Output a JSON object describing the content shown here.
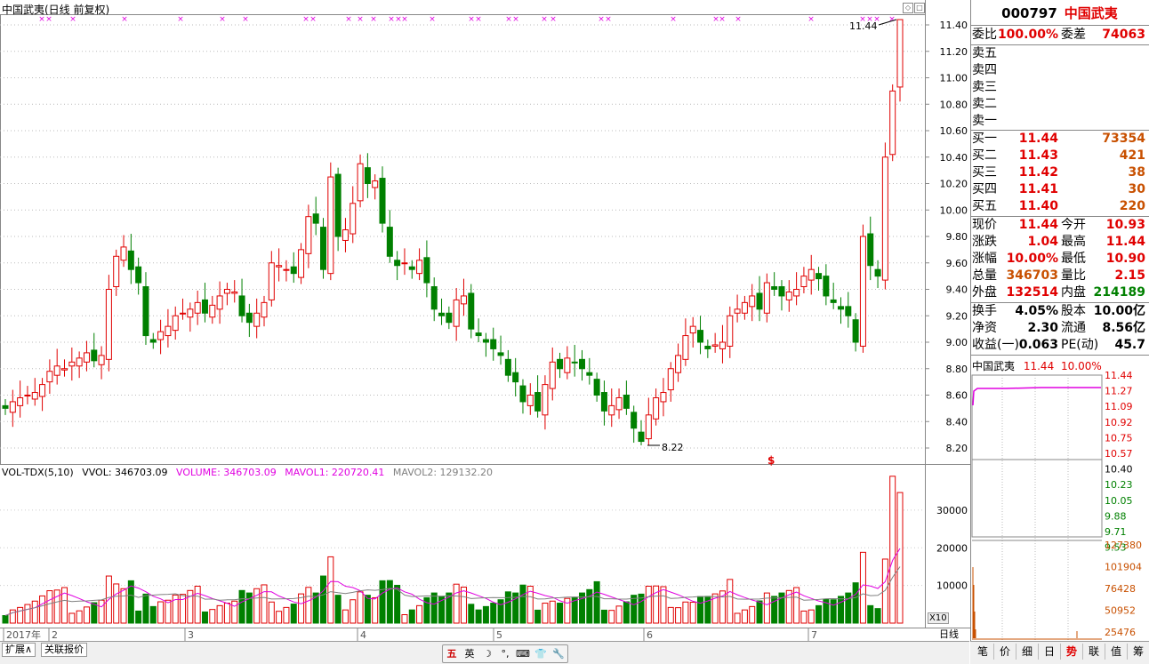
{
  "chart": {
    "title": "中国武夷(日线 前复权)",
    "price_axis": [
      "11.40",
      "11.20",
      "11.00",
      "10.80",
      "10.60",
      "10.40",
      "10.20",
      "10.00",
      "9.80",
      "9.60",
      "9.40",
      "9.20",
      "9.00",
      "8.80",
      "8.60",
      "8.40",
      "8.20"
    ],
    "high_label": "11.44",
    "low_label": "8.22",
    "volume_axis": [
      "30000",
      "20000",
      "10000"
    ],
    "x_labels": [
      "2017年",
      "2",
      "3",
      "4",
      "5",
      "6",
      "7"
    ],
    "scale_label": "X10",
    "period_tab": "日线",
    "marker": "$"
  },
  "volume_legend": {
    "name": "VOL-TDX(5,10)",
    "vvol": "VVOL: 346703.09",
    "volume": "VOLUME: 346703.09",
    "mavol1": "MAVOL1: 220720.41",
    "mavol2": "MAVOL2: 129132.20"
  },
  "bottom_tabs": [
    "扩展∧",
    "关联报价"
  ],
  "ime": [
    "五",
    "英",
    "☽",
    "°,",
    "⌨",
    "👕",
    "🔧"
  ],
  "quote": {
    "code": "000797",
    "name": "中国武夷",
    "weibi_label": "委比",
    "weibi": "100.00%",
    "weicha_label": "委差",
    "weicha": "74063",
    "sell": [
      {
        "label": "卖五"
      },
      {
        "label": "卖四"
      },
      {
        "label": "卖三"
      },
      {
        "label": "卖二"
      },
      {
        "label": "卖一"
      }
    ],
    "buy": [
      {
        "label": "买一",
        "price": "11.44",
        "vol": "73354"
      },
      {
        "label": "买二",
        "price": "11.43",
        "vol": "421"
      },
      {
        "label": "买三",
        "price": "11.42",
        "vol": "38"
      },
      {
        "label": "买四",
        "price": "11.41",
        "vol": "30"
      },
      {
        "label": "买五",
        "price": "11.40",
        "vol": "220"
      }
    ],
    "stats": [
      {
        "l1": "现价",
        "v1": "11.44",
        "l2": "今开",
        "v2": "10.93",
        "c1": "red",
        "c2": "red"
      },
      {
        "l1": "涨跌",
        "v1": "1.04",
        "l2": "最高",
        "v2": "11.44",
        "c1": "red",
        "c2": "red"
      },
      {
        "l1": "涨幅",
        "v1": "10.00%",
        "l2": "最低",
        "v2": "10.90",
        "c1": "red",
        "c2": "red"
      },
      {
        "l1": "总量",
        "v1": "346703",
        "l2": "量比",
        "v2": "2.15",
        "c1": "orange",
        "c2": "red"
      },
      {
        "l1": "外盘",
        "v1": "132514",
        "l2": "内盘",
        "v2": "214189",
        "c1": "red",
        "c2": "green"
      }
    ],
    "fund": [
      {
        "l1": "换手",
        "v1": "4.05%",
        "l2": "股本",
        "v2": "10.00亿"
      },
      {
        "l1": "净资",
        "v1": "2.30",
        "l2": "流通",
        "v2": "8.56亿"
      },
      {
        "l1": "收益(一)",
        "v1": "0.063",
        "l2": "PE(动)",
        "v2": "45.7"
      }
    ]
  },
  "mini_chart": {
    "title": "中国武夷",
    "price": "11.44",
    "pct": "10.00%",
    "price_axis": [
      "11.44",
      "11.27",
      "11.09",
      "10.92",
      "10.75",
      "10.57",
      "10.40",
      "10.23",
      "10.05",
      "9.88",
      "9.71",
      "9.53"
    ],
    "vol_axis": [
      "127380",
      "101904",
      "76428",
      "50952",
      "25476"
    ]
  },
  "right_tabs": [
    "笔",
    "价",
    "细",
    "日",
    "势",
    "联",
    "值",
    "筹"
  ],
  "colors": {
    "up": "#e00000",
    "down": "#008000",
    "ma1": "#e000e0",
    "ma2": "#808080"
  }
}
